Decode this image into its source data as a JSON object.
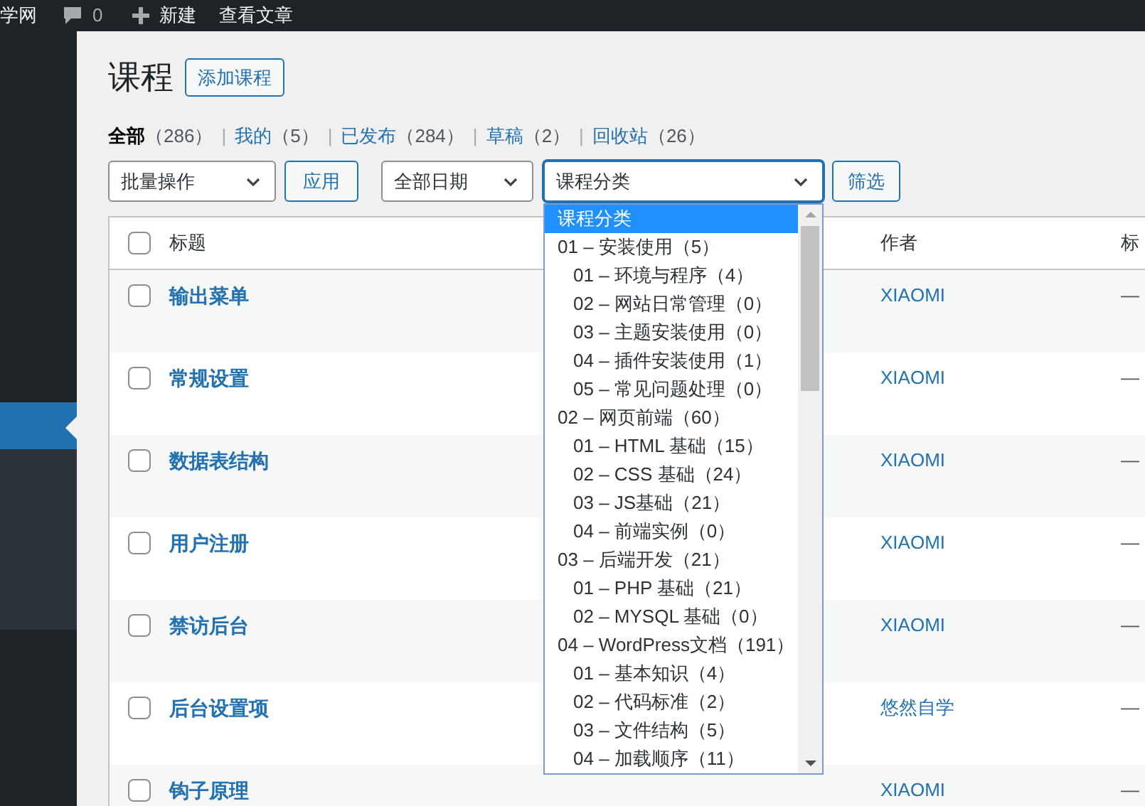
{
  "admin_bar": {
    "site_name": "学网",
    "comments_count": "0",
    "new_label": "新建",
    "view_label": "查看文章"
  },
  "page": {
    "title": "课程",
    "add_button": "添加课程"
  },
  "views": [
    {
      "label": "全部",
      "count": "（286）",
      "selected": true
    },
    {
      "separator": "|",
      "label": "我的",
      "count": "（5）",
      "selected": false
    },
    {
      "separator": "|",
      "label": "已发布",
      "count": "（284）",
      "selected": false
    },
    {
      "separator": "|",
      "label": "草稿",
      "count": "（2）",
      "selected": false
    },
    {
      "separator": "|",
      "label": "回收站",
      "count": "（26）",
      "selected": false
    }
  ],
  "filters": {
    "bulk_action": "批量操作",
    "apply_button": "应用",
    "date": "全部日期",
    "category": {
      "value": "课程分类",
      "expanded": true
    },
    "filter_button": "筛选"
  },
  "category_options": [
    {
      "label": "课程分类",
      "selected": true
    },
    {
      "label": "01 – 安装使用（5）",
      "selected": false,
      "children": [
        {
          "label": "01 – 环境与程序（4）",
          "selected": false
        },
        {
          "label": "02 – 网站日常管理（0）",
          "selected": false
        },
        {
          "label": "03 – 主题安装使用（0）",
          "selected": false
        },
        {
          "label": "04 – 插件安装使用（1）",
          "selected": false
        },
        {
          "label": "05 – 常见问题处理（0）",
          "selected": false
        }
      ]
    },
    {
      "label": "02 – 网页前端（60）",
      "selected": false,
      "children": [
        {
          "label": "01 – HTML 基础（15）",
          "selected": false
        },
        {
          "label": "02 – CSS 基础（24）",
          "selected": false
        },
        {
          "label": "03 – JS基础（21）",
          "selected": false
        },
        {
          "label": "04 – 前端实例（0）",
          "selected": false
        }
      ]
    },
    {
      "label": "03 – 后端开发（21）",
      "selected": false,
      "children": [
        {
          "label": "01 – PHP 基础（21）",
          "selected": false
        },
        {
          "label": "02 – MYSQL 基础（0）",
          "selected": false
        }
      ]
    },
    {
      "label": "04 – WordPress文档（191）",
      "selected": false,
      "children": [
        {
          "label": "01 – 基本知识（4）",
          "selected": false
        },
        {
          "label": "02 – 代码标准（2）",
          "selected": false
        },
        {
          "label": "03 – 文件结构（5）",
          "selected": false
        },
        {
          "label": "04 – 加载顺序（11）",
          "selected": false
        }
      ]
    }
  ],
  "table": {
    "select_all_checked": false,
    "columns": [
      "标题",
      "作者",
      "标"
    ],
    "rows": [
      {
        "title": "输出菜单",
        "author": "XIAOMI",
        "column_3": "—",
        "checked": false
      },
      {
        "title": "常规设置",
        "author": "XIAOMI",
        "column_3": "—",
        "checked": false
      },
      {
        "title": "数据表结构",
        "author": "XIAOMI",
        "column_3": "—",
        "checked": false
      },
      {
        "title": "用户注册",
        "author": "XIAOMI",
        "column_3": "—",
        "checked": false
      },
      {
        "title": "禁访后台",
        "author": "XIAOMI",
        "column_3": "—",
        "checked": false
      },
      {
        "title": "后台设置项",
        "author": "悠然自学",
        "column_3": "—",
        "checked": false
      },
      {
        "title": "钩子原理",
        "author": "XIAOMI",
        "column_3": "—",
        "checked": false
      }
    ]
  }
}
